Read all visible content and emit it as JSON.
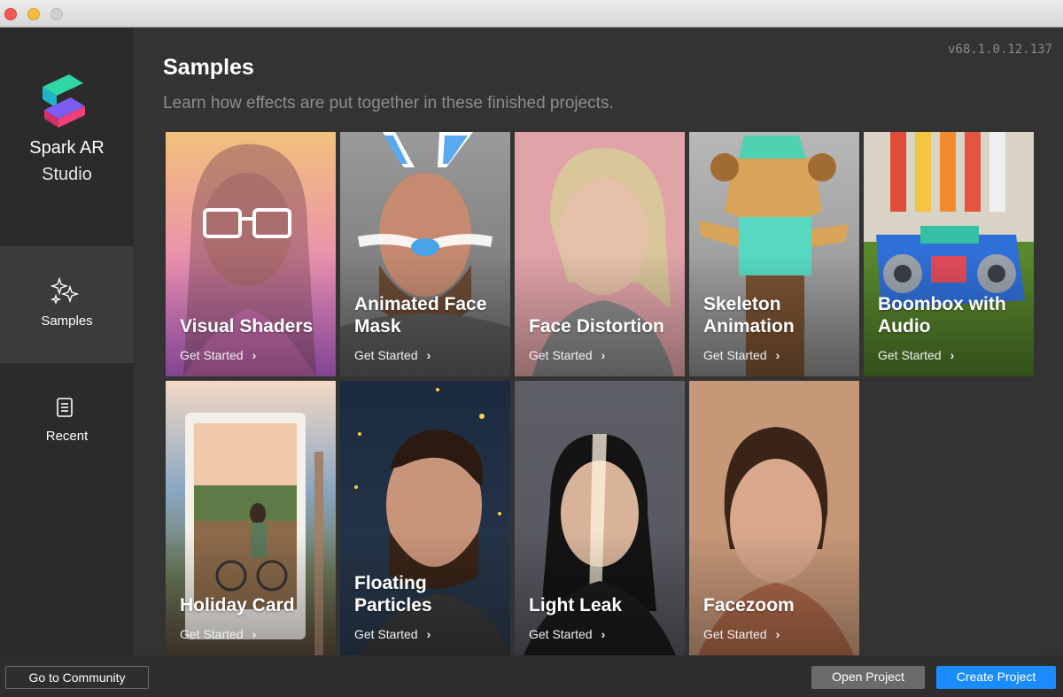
{
  "window": {
    "controls": [
      "close",
      "minimize",
      "zoom"
    ]
  },
  "sidebar": {
    "brand_name": "Spark AR",
    "brand_sub": "Studio",
    "items": [
      {
        "label": "Samples",
        "icon": "sparkles-icon",
        "selected": true
      },
      {
        "label": "Recent",
        "icon": "document-icon",
        "selected": false
      }
    ]
  },
  "main": {
    "version": "v68.1.0.12.137",
    "title": "Samples",
    "subtitle": "Learn how effects are put together in these finished projects.",
    "cards": [
      {
        "title": "Visual Shaders",
        "cta": "Get Started"
      },
      {
        "title": "Animated Face Mask",
        "cta": "Get Started"
      },
      {
        "title": "Face Distortion",
        "cta": "Get Started"
      },
      {
        "title": "Skeleton Animation",
        "cta": "Get Started"
      },
      {
        "title": "Boombox with Audio",
        "cta": "Get Started"
      },
      {
        "title": "Holiday Card",
        "cta": "Get Started"
      },
      {
        "title": "Floating Particles",
        "cta": "Get Started"
      },
      {
        "title": "Light Leak",
        "cta": "Get Started"
      },
      {
        "title": "Facezoom",
        "cta": "Get Started"
      }
    ]
  },
  "footer": {
    "community_label": "Go to Community",
    "open_label": "Open Project",
    "create_label": "Create Project"
  },
  "colors": {
    "accent": "#1a8cff",
    "sidebar_bg": "#2b2b2b",
    "selected_bg": "#3b3b3b",
    "main_bg": "#333333"
  }
}
